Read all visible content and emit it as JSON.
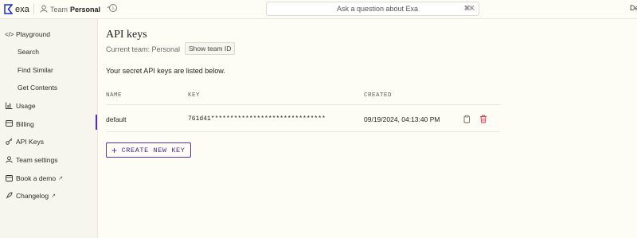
{
  "header": {
    "logo_text": "exa",
    "team_label": "Team",
    "team_value": "Personal",
    "search_placeholder": "Ask a question about Exa",
    "search_shortcut": "⌘K",
    "user_trunc": "De"
  },
  "sidebar": {
    "items": [
      {
        "label": "Playground",
        "icon": "code-icon"
      },
      {
        "label": "Search",
        "icon": ""
      },
      {
        "label": "Find Similar",
        "icon": ""
      },
      {
        "label": "Get Contents",
        "icon": ""
      },
      {
        "label": "Usage",
        "icon": "bar-chart-icon"
      },
      {
        "label": "Billing",
        "icon": "card-icon"
      },
      {
        "label": "API Keys",
        "icon": "key-icon"
      },
      {
        "label": "Team settings",
        "icon": "person-icon"
      },
      {
        "label": "Book a demo",
        "icon": "calendar-icon"
      },
      {
        "label": "Changelog",
        "icon": "rocket-icon"
      }
    ],
    "active": "API Keys"
  },
  "main": {
    "title": "API keys",
    "current_team": "Current team: Personal",
    "show_team_id": "Show team ID",
    "description": "Your secret API keys are listed below.",
    "columns": [
      "NAME",
      "KEY",
      "CREATED"
    ],
    "rows": [
      {
        "name": "default",
        "key": "761d41******************************",
        "created": "09/19/2024, 04:13:40 PM"
      }
    ],
    "create_button": "CREATE NEW KEY"
  },
  "colors": {
    "accent": "#5a2db8",
    "delete": "#d43a4a",
    "background": "#fdfcf5",
    "sidebar": "#f7f6ee"
  }
}
